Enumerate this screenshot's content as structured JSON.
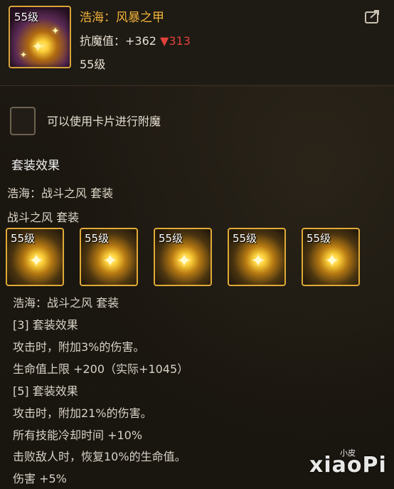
{
  "item": {
    "level_badge": "55级",
    "title": "浩海：风暴之甲",
    "resist_label": "抗魔值：+362",
    "resist_down": "▼313",
    "level": "55级"
  },
  "enchant": {
    "label": "可以使用卡片进行附魔"
  },
  "set": {
    "heading": "套装效果",
    "name_line1": "浩海：战斗之风  套装",
    "name_line2": "战斗之风  套装",
    "pieces": [
      {
        "level": "55级"
      },
      {
        "level": "55级"
      },
      {
        "level": "55级"
      },
      {
        "level": "55级"
      },
      {
        "level": "55级"
      }
    ],
    "lines": [
      "浩海：战斗之风  套装",
      "[3] 套装效果",
      "攻击时，附加3%的伤害。",
      "生命值上限 +200（实际+1045）",
      "[5] 套装效果",
      "攻击时，附加21%的伤害。",
      "所有技能冷却时间 +10%",
      "击败敌人时，恢复10%的生命值。",
      "伤害 +5%"
    ]
  },
  "watermark": {
    "text": "xiaoPi",
    "sub": "小皮"
  },
  "icons": {
    "share": "share-icon",
    "sparkle": "sparkle-icon"
  },
  "colors": {
    "title": "#f2b43a",
    "down": "#e2413a",
    "border": "#e0aa36"
  }
}
